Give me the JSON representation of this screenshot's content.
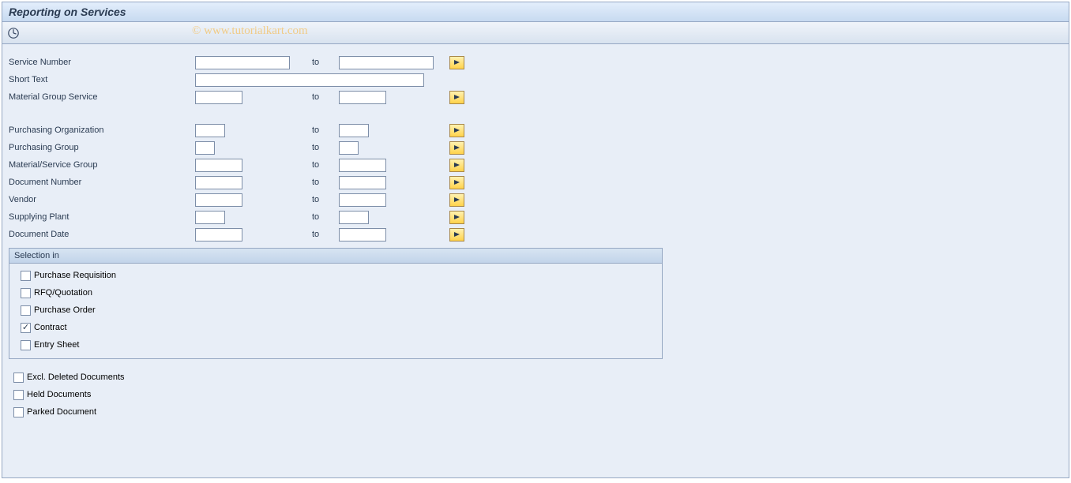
{
  "title": "Reporting on Services",
  "watermark": "© www.tutorialkart.com",
  "labels": {
    "to": "to"
  },
  "fields": {
    "service_number": {
      "label": "Service Number",
      "from": "",
      "to_val": ""
    },
    "short_text": {
      "label": "Short Text",
      "value": ""
    },
    "mat_grp_svc": {
      "label": "Material Group Service",
      "from": "",
      "to_val": ""
    },
    "purch_org": {
      "label": "Purchasing Organization",
      "from": "",
      "to_val": ""
    },
    "purch_grp": {
      "label": "Purchasing Group",
      "from": "",
      "to_val": ""
    },
    "mat_svc_grp": {
      "label": "Material/Service Group",
      "from": "",
      "to_val": ""
    },
    "doc_number": {
      "label": "Document Number",
      "from": "",
      "to_val": ""
    },
    "vendor": {
      "label": "Vendor",
      "from": "",
      "to_val": ""
    },
    "supply_plant": {
      "label": "Supplying Plant",
      "from": "",
      "to_val": ""
    },
    "doc_date": {
      "label": "Document Date",
      "from": "",
      "to_val": ""
    }
  },
  "selection_in": {
    "title": "Selection in",
    "items": [
      {
        "label": "Purchase Requisition",
        "checked": false
      },
      {
        "label": "RFQ/Quotation",
        "checked": false
      },
      {
        "label": "Purchase Order",
        "checked": false
      },
      {
        "label": "Contract",
        "checked": true
      },
      {
        "label": "Entry Sheet",
        "checked": false
      }
    ]
  },
  "bottom": [
    {
      "label": "Excl. Deleted Documents",
      "checked": false
    },
    {
      "label": "Held Documents",
      "checked": false
    },
    {
      "label": "Parked Document",
      "checked": false
    }
  ]
}
